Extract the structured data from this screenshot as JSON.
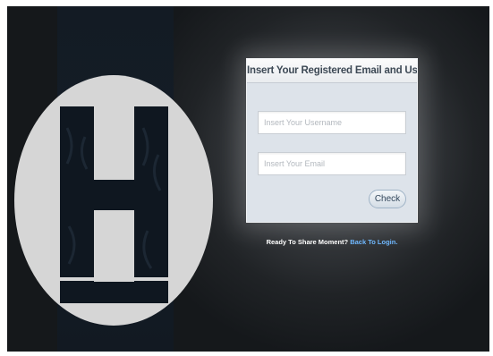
{
  "form": {
    "title": "Insert Your Registered Email and Username",
    "username_placeholder": "Insert Your Username",
    "email_placeholder": "Insert Your Email",
    "check_label": "Check"
  },
  "footer": {
    "prompt": "Ready To Share Moment?",
    "link": "Back To Login."
  },
  "colors": {
    "logo_circle": "#d6d6d6",
    "logo_letter": "#0f1720",
    "link": "#6fb8ff",
    "card_bg": "#dde3ea"
  },
  "logo": {
    "icon": "letter-h-logo"
  }
}
